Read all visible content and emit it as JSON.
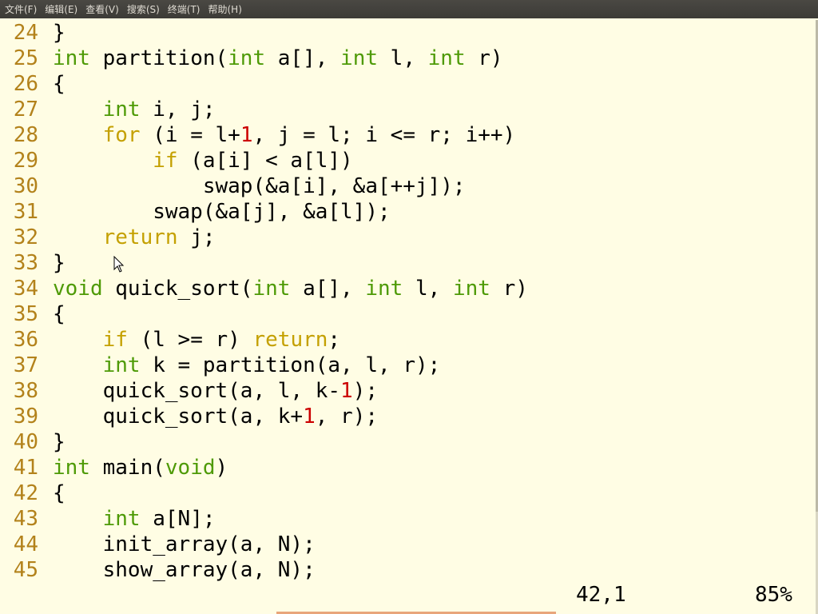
{
  "menubar": {
    "items": [
      "文件(F)",
      "编辑(E)",
      "查看(V)",
      "搜索(S)",
      "终端(T)",
      "帮助(H)"
    ]
  },
  "editor": {
    "lines": [
      {
        "n": "24",
        "tokens": [
          [
            "p",
            "}"
          ]
        ]
      },
      {
        "n": "25",
        "tokens": [
          [
            "t",
            "int"
          ],
          [
            "p",
            " partition("
          ],
          [
            "t",
            "int"
          ],
          [
            "p",
            " a[], "
          ],
          [
            "t",
            "int"
          ],
          [
            "p",
            " l, "
          ],
          [
            "t",
            "int"
          ],
          [
            "p",
            " r)"
          ]
        ]
      },
      {
        "n": "26",
        "tokens": [
          [
            "p",
            "{"
          ]
        ]
      },
      {
        "n": "27",
        "tokens": [
          [
            "p",
            "    "
          ],
          [
            "t",
            "int"
          ],
          [
            "p",
            " i, j;"
          ]
        ]
      },
      {
        "n": "28",
        "tokens": [
          [
            "p",
            "    "
          ],
          [
            "c",
            "for"
          ],
          [
            "p",
            " (i = l+"
          ],
          [
            "n",
            "1"
          ],
          [
            "p",
            ", j = l; i <= r; i++)"
          ]
        ]
      },
      {
        "n": "29",
        "tokens": [
          [
            "p",
            "        "
          ],
          [
            "c",
            "if"
          ],
          [
            "p",
            " (a[i] < a[l])"
          ]
        ]
      },
      {
        "n": "30",
        "tokens": [
          [
            "p",
            "            swap(&a[i], &a[++j]);"
          ]
        ]
      },
      {
        "n": "31",
        "tokens": [
          [
            "p",
            "        swap(&a[j], &a[l]);"
          ]
        ]
      },
      {
        "n": "32",
        "tokens": [
          [
            "p",
            "    "
          ],
          [
            "c",
            "return"
          ],
          [
            "p",
            " j;"
          ]
        ]
      },
      {
        "n": "33",
        "tokens": [
          [
            "p",
            "}"
          ]
        ]
      },
      {
        "n": "34",
        "tokens": [
          [
            "t",
            "void"
          ],
          [
            "p",
            " quick_sort("
          ],
          [
            "t",
            "int"
          ],
          [
            "p",
            " a[], "
          ],
          [
            "t",
            "int"
          ],
          [
            "p",
            " l, "
          ],
          [
            "t",
            "int"
          ],
          [
            "p",
            " r)"
          ]
        ]
      },
      {
        "n": "35",
        "tokens": [
          [
            "p",
            "{"
          ]
        ]
      },
      {
        "n": "36",
        "tokens": [
          [
            "p",
            "    "
          ],
          [
            "c",
            "if"
          ],
          [
            "p",
            " (l >= r) "
          ],
          [
            "c",
            "return"
          ],
          [
            "p",
            ";"
          ]
        ]
      },
      {
        "n": "37",
        "tokens": [
          [
            "p",
            "    "
          ],
          [
            "t",
            "int"
          ],
          [
            "p",
            " k = partition(a, l, r);"
          ]
        ]
      },
      {
        "n": "38",
        "tokens": [
          [
            "p",
            "    quick_sort(a, l, k-"
          ],
          [
            "n",
            "1"
          ],
          [
            "p",
            ");"
          ]
        ]
      },
      {
        "n": "39",
        "tokens": [
          [
            "p",
            "    quick_sort(a, k+"
          ],
          [
            "n",
            "1"
          ],
          [
            "p",
            ", r);"
          ]
        ]
      },
      {
        "n": "40",
        "tokens": [
          [
            "p",
            "}"
          ]
        ]
      },
      {
        "n": "41",
        "tokens": [
          [
            "t",
            "int"
          ],
          [
            "p",
            " main("
          ],
          [
            "t",
            "void"
          ],
          [
            "p",
            ")"
          ]
        ]
      },
      {
        "n": "42",
        "tokens": [
          [
            "p",
            "{"
          ]
        ]
      },
      {
        "n": "43",
        "tokens": [
          [
            "p",
            "    "
          ],
          [
            "t",
            "int"
          ],
          [
            "p",
            " a[N];"
          ]
        ]
      },
      {
        "n": "44",
        "tokens": [
          [
            "p",
            "    init_array(a, N);"
          ]
        ]
      },
      {
        "n": "45",
        "tokens": [
          [
            "p",
            "    show_array(a, N);"
          ]
        ]
      }
    ]
  },
  "status": {
    "cursor_position": "42,1",
    "scroll_percent": "85%"
  },
  "colors": {
    "background": "#fffde4",
    "line_number": "#b3821b",
    "type_keyword": "#4e9a06",
    "control_keyword": "#c4a000",
    "number_literal": "#cc0000"
  }
}
